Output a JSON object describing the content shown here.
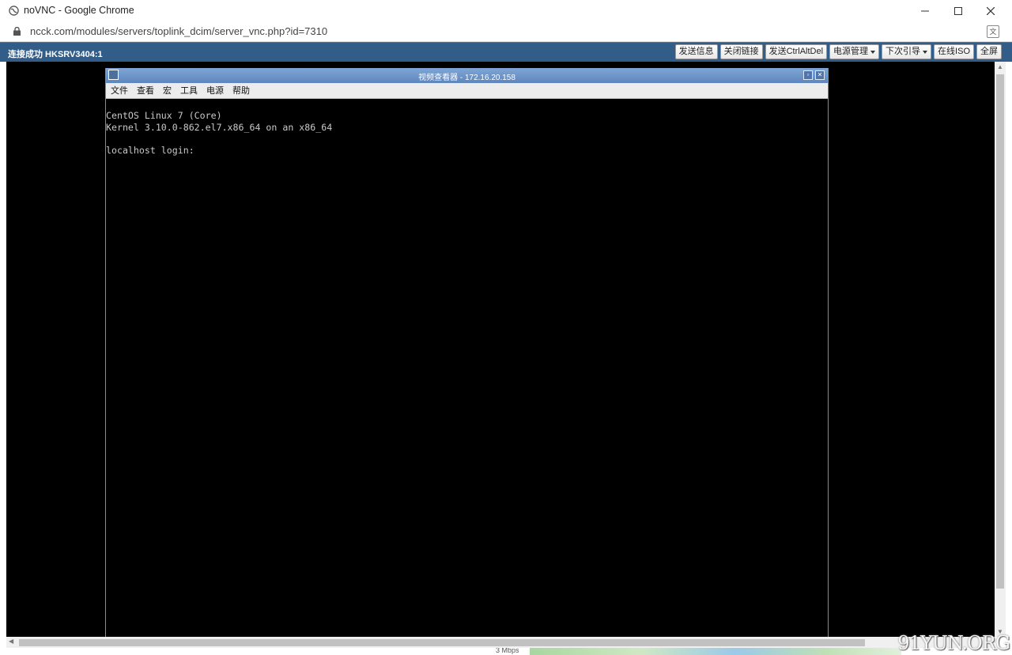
{
  "browser": {
    "window_title": "noVNC - Google Chrome",
    "url": "ncck.com/modules/servers/toplink_dcim/server_vnc.php?id=7310"
  },
  "vnc_toolbar": {
    "status": "连接成功 HKSRV3404:1",
    "buttons": [
      {
        "label": "发送信息",
        "dropdown": false
      },
      {
        "label": "关闭链接",
        "dropdown": false
      },
      {
        "label": "发送CtrlAltDel",
        "dropdown": false
      },
      {
        "label": "电源管理",
        "dropdown": true
      },
      {
        "label": "下次引导",
        "dropdown": true
      },
      {
        "label": "在线ISO",
        "dropdown": false
      },
      {
        "label": "全屏",
        "dropdown": false
      }
    ]
  },
  "viewer": {
    "title": "视频查看器 - 172.16.20.158",
    "menu": [
      "文件",
      "查看",
      "宏",
      "工具",
      "电源",
      "帮助"
    ],
    "console_lines": [
      "CentOS Linux 7 (Core)",
      "Kernel 3.10.0-862.el7.x86_64 on an x86_64",
      "",
      "localhost login:"
    ]
  },
  "footer": {
    "speed": "3 Mbps",
    "watermark": "91YUN.ORG"
  },
  "colors": {
    "vnc_bar": "#335d89",
    "viewer_title": "#6d93c8",
    "console_bg": "#000000",
    "console_text": "#c9c9c9"
  }
}
